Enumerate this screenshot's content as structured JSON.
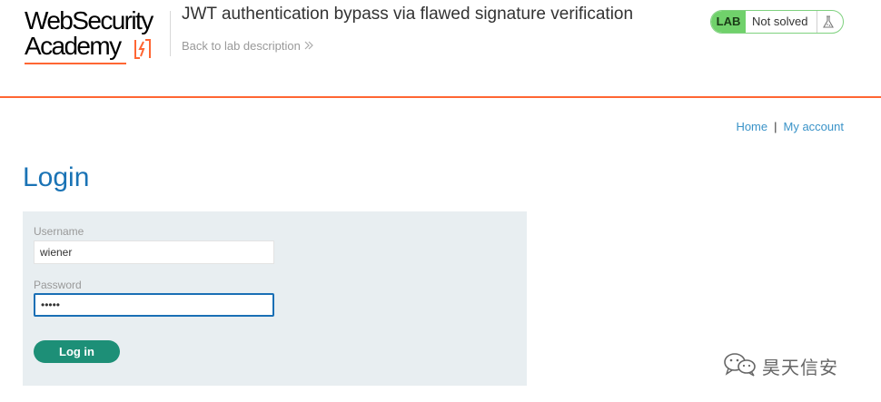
{
  "logo": {
    "line1": "WebSecurity",
    "line2": "Academy"
  },
  "lab": {
    "title": "JWT authentication bypass via flawed signature verification",
    "back_link": "Back to lab description",
    "badge": "LAB",
    "status": "Not solved"
  },
  "nav": {
    "home": "Home",
    "separator": "|",
    "account": "My account"
  },
  "login": {
    "title": "Login",
    "username_label": "Username",
    "username_value": "wiener",
    "password_label": "Password",
    "password_value": "peter",
    "button": "Log in"
  },
  "watermark": {
    "text": "昊天信安"
  },
  "colors": {
    "accent": "#ff6633",
    "link": "#3a93c8",
    "title": "#1a73b5",
    "button": "#1d8f77",
    "status_green": "#70d16b",
    "panel": "#e8eef1"
  },
  "icons": [
    "lightning-bolt-icon",
    "chevron-right-double-icon",
    "flask-icon",
    "wechat-icon"
  ]
}
